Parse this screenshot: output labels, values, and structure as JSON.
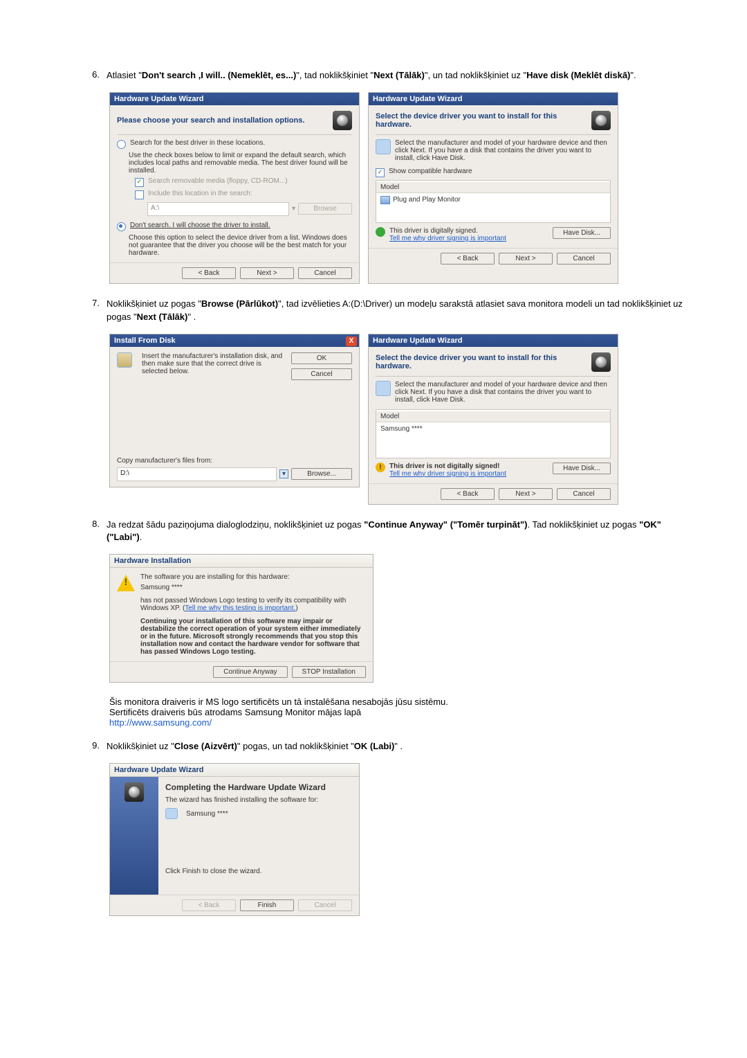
{
  "step6": {
    "num": "6.",
    "text_a": "Atlasiet \"",
    "bold_a": "Don't search ,I will.. (Nemeklēt, es...)",
    "text_b": "\", tad noklikšķiniet \"",
    "bold_b": "Next (Tālāk)",
    "text_c": "\", un tad noklikšķiniet uz \"",
    "bold_c": "Have disk (Meklēt diskā)",
    "text_d": "\"."
  },
  "step7": {
    "num": "7.",
    "text_a": "Noklikšķiniet uz pogas \"",
    "bold_a": "Browse (Pārlūkot)",
    "text_b": "\", tad izvēlieties A:(D:\\Driver) un modeļu sarakstā atlasiet sava monitora modeli un tad noklikšķiniet uz pogas \"",
    "bold_b": "Next (Tālāk)",
    "text_c": "\" ."
  },
  "step8": {
    "num": "8.",
    "text_a": "Ja redzat šādu paziņojuma dialoglodziņu, noklikšķiniet uz pogas ",
    "bold_a": "\"Continue Anyway\" (\"Tomēr turpināt\")",
    "text_b": ". Tad noklikšķiniet uz pogas ",
    "bold_b": "\"OK\" (\"Labi\")",
    "text_c": "."
  },
  "step8_note": {
    "line1": "Šis monitora draiveris ir MS logo sertificēts un tā instalēšana nesabojās jūsu sistēmu.",
    "line2": "Sertificēts draiveris būs atrodams Samsung Monitor mājas lapā",
    "url": "http://www.samsung.com/"
  },
  "step9": {
    "num": "9.",
    "text_a": "Noklikšķiniet uz \"",
    "bold_a": "Close (Aizvērt)",
    "text_b": "\" pogas, un tad noklikšķiniet \"",
    "bold_b": "OK (Labi)",
    "text_c": "\" ."
  },
  "wiz_title": "Hardware Update Wizard",
  "wiz1": {
    "headline": "Please choose your search and installation options.",
    "r1": "Search for the best driver in these locations.",
    "r1_desc": "Use the check boxes below to limit or expand the default search, which includes local paths and removable media. The best driver found will be installed.",
    "c1": "Search removable media (floppy, CD-ROM...)",
    "c2": "Include this location in the search:",
    "path": "A:\\",
    "browse": "Browse",
    "r2": "Don't search. I will choose the driver to install.",
    "r2_desc": "Choose this option to select the device driver from a list. Windows does not guarantee that the driver you choose will be the best match for your hardware."
  },
  "wiz2": {
    "headline": "Select the device driver you want to install for this hardware.",
    "sub": "Select the manufacturer and model of your hardware device and then click Next. If you have a disk that contains the driver you want to install, click Have Disk.",
    "show_compat": "Show compatible hardware",
    "model": "Model",
    "item": "Plug and Play Monitor",
    "signed": "This driver is digitally signed.",
    "tell": "Tell me why driver signing is important",
    "have_disk": "Have Disk..."
  },
  "install_disk": {
    "title": "Install From Disk",
    "msg": "Insert the manufacturer's installation disk, and then make sure that the correct drive is selected below.",
    "copy": "Copy manufacturer's files from:",
    "path": "D:\\",
    "ok": "OK",
    "cancel": "Cancel",
    "browse": "Browse..."
  },
  "wiz3": {
    "headline": "Select the device driver you want to install for this hardware.",
    "sub": "Select the manufacturer and model of your hardware device and then click Next. If you have a disk that contains the driver you want to install, click Have Disk.",
    "model": "Model",
    "item": "Samsung ****",
    "not_signed": "This driver is not digitally signed!",
    "tell": "Tell me why driver signing is important",
    "have_disk": "Have Disk..."
  },
  "hwi": {
    "title": "Hardware Installation",
    "line1": "The software you are installing for this hardware:",
    "device": "Samsung ****",
    "line2a": "has not passed Windows Logo testing to verify its compatibility with Windows XP. (",
    "line2b": "Tell me why this testing is important.",
    "line2c": ")",
    "warn": "Continuing your installation of this software may impair or destabilize the correct operation of your system either immediately or in the future. Microsoft strongly recommends that you stop this installation now and contact the hardware vendor for software that has passed Windows Logo testing.",
    "cont": "Continue Anyway",
    "stop": "STOP Installation"
  },
  "complete": {
    "title": "Hardware Update Wizard",
    "headline": "Completing the Hardware Update Wizard",
    "sub": "The wizard has finished installing the software for:",
    "device": "Samsung ****",
    "closing": "Click Finish to close the wizard.",
    "finish": "Finish"
  },
  "nav": {
    "back": "< Back",
    "next": "Next >",
    "cancel": "Cancel"
  }
}
